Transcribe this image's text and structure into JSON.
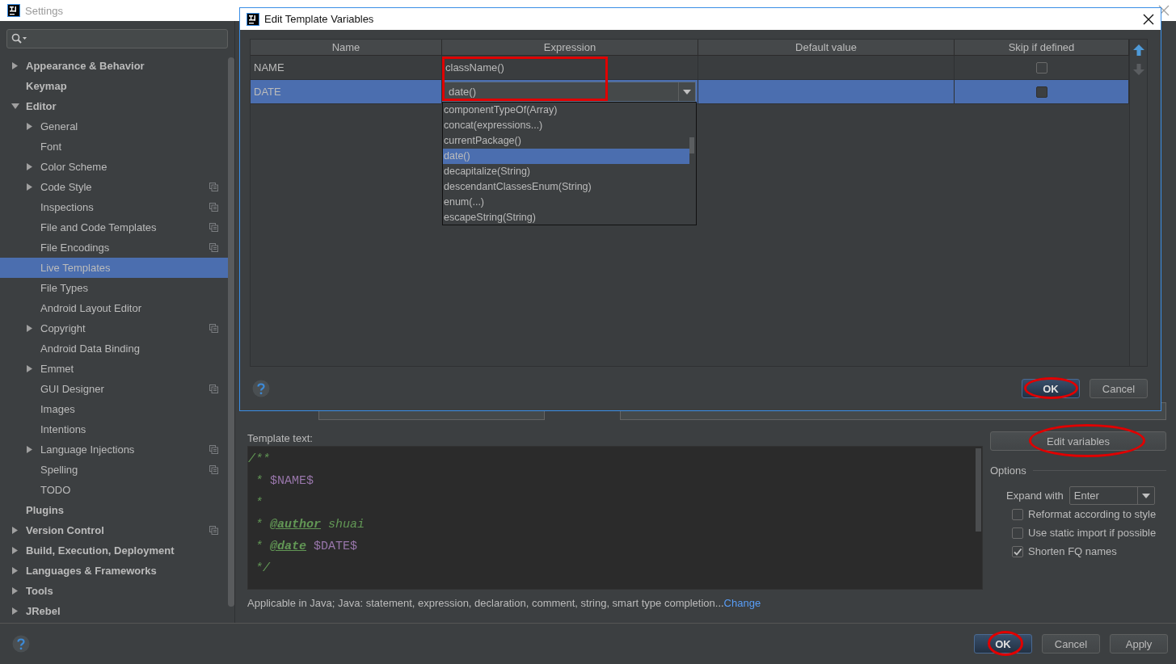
{
  "window": {
    "title": "Settings"
  },
  "sidebar": {
    "items": [
      {
        "label": "Appearance & Behavior",
        "kind": "collapsed",
        "selected": false,
        "project_level": false
      },
      {
        "label": "Keymap",
        "kind": "leaf",
        "selected": false,
        "project_level": false
      },
      {
        "label": "Editor",
        "kind": "expanded",
        "selected": false,
        "project_level": false,
        "children": [
          {
            "label": "General",
            "kind": "collapsed",
            "selected": false,
            "project_level": false
          },
          {
            "label": "Font",
            "kind": "leaf",
            "selected": false,
            "project_level": false
          },
          {
            "label": "Color Scheme",
            "kind": "collapsed",
            "selected": false,
            "project_level": false
          },
          {
            "label": "Code Style",
            "kind": "collapsed",
            "selected": false,
            "project_level": true
          },
          {
            "label": "Inspections",
            "kind": "leaf",
            "selected": false,
            "project_level": true
          },
          {
            "label": "File and Code Templates",
            "kind": "leaf",
            "selected": false,
            "project_level": true
          },
          {
            "label": "File Encodings",
            "kind": "leaf",
            "selected": false,
            "project_level": true
          },
          {
            "label": "Live Templates",
            "kind": "leaf",
            "selected": true,
            "project_level": false
          },
          {
            "label": "File Types",
            "kind": "leaf",
            "selected": false,
            "project_level": false
          },
          {
            "label": "Android Layout Editor",
            "kind": "leaf",
            "selected": false,
            "project_level": false
          },
          {
            "label": "Copyright",
            "kind": "collapsed",
            "selected": false,
            "project_level": true
          },
          {
            "label": "Android Data Binding",
            "kind": "leaf",
            "selected": false,
            "project_level": false
          },
          {
            "label": "Emmet",
            "kind": "collapsed",
            "selected": false,
            "project_level": false
          },
          {
            "label": "GUI Designer",
            "kind": "leaf",
            "selected": false,
            "project_level": true
          },
          {
            "label": "Images",
            "kind": "leaf",
            "selected": false,
            "project_level": false
          },
          {
            "label": "Intentions",
            "kind": "leaf",
            "selected": false,
            "project_level": false
          },
          {
            "label": "Language Injections",
            "kind": "collapsed",
            "selected": false,
            "project_level": true
          },
          {
            "label": "Spelling",
            "kind": "leaf",
            "selected": false,
            "project_level": true
          },
          {
            "label": "TODO",
            "kind": "leaf",
            "selected": false,
            "project_level": false
          }
        ]
      },
      {
        "label": "Plugins",
        "kind": "leaf",
        "selected": false,
        "project_level": false
      },
      {
        "label": "Version Control",
        "kind": "collapsed",
        "selected": false,
        "project_level": true
      },
      {
        "label": "Build, Execution, Deployment",
        "kind": "collapsed",
        "selected": false,
        "project_level": false
      },
      {
        "label": "Languages & Frameworks",
        "kind": "collapsed",
        "selected": false,
        "project_level": false
      },
      {
        "label": "Tools",
        "kind": "collapsed",
        "selected": false,
        "project_level": false
      },
      {
        "label": "JRebel",
        "kind": "collapsed",
        "selected": false,
        "project_level": false
      }
    ]
  },
  "template": {
    "label": "Template text:",
    "lines": [
      {
        "segments": [
          {
            "text": "/**",
            "kind": "comment"
          }
        ]
      },
      {
        "segments": [
          {
            "text": " * ",
            "kind": "comment"
          },
          {
            "text": "$NAME$",
            "kind": "variable"
          }
        ]
      },
      {
        "segments": [
          {
            "text": " *",
            "kind": "comment"
          }
        ]
      },
      {
        "segments": [
          {
            "text": " * ",
            "kind": "comment"
          },
          {
            "text": "@author",
            "kind": "tag"
          },
          {
            "text": " shuai",
            "kind": "comment"
          }
        ]
      },
      {
        "segments": [
          {
            "text": " * ",
            "kind": "comment"
          },
          {
            "text": "@date",
            "kind": "tag"
          },
          {
            "text": " $DATE$",
            "kind": "variable"
          }
        ]
      },
      {
        "segments": [
          {
            "text": " */",
            "kind": "comment"
          }
        ]
      }
    ],
    "applicable": "Applicable in Java; Java: statement, expression, declaration, comment, string, smart type completion...",
    "change_link": "Change"
  },
  "options": {
    "edit_button": {
      "label": "Edit variables",
      "highlighted": true
    },
    "title": "Options",
    "expand_label": "Expand with",
    "expand_value": "Enter",
    "checkboxes": [
      {
        "label": "Reformat according to style",
        "checked": false
      },
      {
        "label": "Use static import if possible",
        "checked": false
      },
      {
        "label": "Shorten FQ names",
        "checked": true
      }
    ]
  },
  "footer": {
    "buttons": [
      {
        "label": "OK",
        "default": true,
        "highlighted": true
      },
      {
        "label": "Cancel",
        "default": false,
        "highlighted": false
      },
      {
        "label": "Apply",
        "default": false,
        "highlighted": false
      }
    ]
  },
  "dialog": {
    "title": "Edit Template Variables",
    "columns": [
      {
        "label": "Name",
        "highlighted": false
      },
      {
        "label": "Expression",
        "highlighted": true
      },
      {
        "label": "Default value",
        "highlighted": false
      },
      {
        "label": "Skip if defined",
        "highlighted": false
      }
    ],
    "rows": [
      {
        "name": "NAME",
        "expression": "className()",
        "editing": false,
        "skip_if_defined": false,
        "selected": false
      },
      {
        "name": "DATE",
        "expression": "date()",
        "editing": true,
        "skip_if_defined": false,
        "selected": true
      }
    ],
    "completion": [
      {
        "label": "componentTypeOf(Array)",
        "selected": false
      },
      {
        "label": "concat(expressions...)",
        "selected": false
      },
      {
        "label": "currentPackage()",
        "selected": false
      },
      {
        "label": "date()",
        "selected": true
      },
      {
        "label": "decapitalize(String)",
        "selected": false
      },
      {
        "label": "descendantClassesEnum(String)",
        "selected": false
      },
      {
        "label": "enum(...)",
        "selected": false
      },
      {
        "label": "escapeString(String)",
        "selected": false
      }
    ],
    "buttons": [
      {
        "label": "OK",
        "default": true,
        "highlighted": true
      },
      {
        "label": "Cancel",
        "default": false,
        "highlighted": false
      }
    ]
  }
}
